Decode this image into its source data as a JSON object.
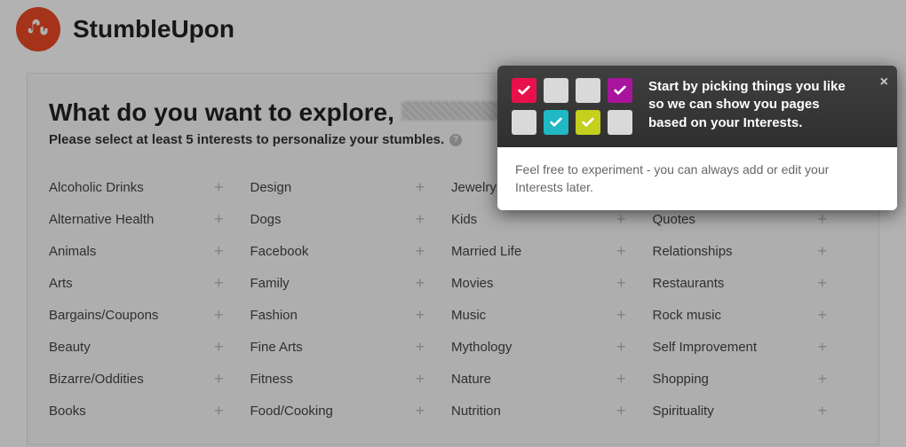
{
  "brand": "StumbleUpon",
  "heading_prefix": "What do you want to explore,",
  "subheading": "Please select at least 5 interests to personalize your stumbles.",
  "interests": {
    "col1": [
      "Alcoholic Drinks",
      "Alternative Health",
      "Animals",
      "Arts",
      "Bargains/Coupons",
      "Beauty",
      "Bizarre/Oddities",
      "Books"
    ],
    "col2": [
      "Design",
      "Dogs",
      "Facebook",
      "Family",
      "Fashion",
      "Fine Arts",
      "Fitness",
      "Food/Cooking"
    ],
    "col3": [
      "Jewelry",
      "Kids",
      "Married Life",
      "Movies",
      "Music",
      "Mythology",
      "Nature",
      "Nutrition"
    ],
    "col4": [
      "",
      "Quotes",
      "Relationships",
      "Restaurants",
      "Rock music",
      "Self Improvement",
      "Shopping",
      "Spirituality"
    ]
  },
  "popover": {
    "headline": "Start by picking things you like so we can show you pages based on your Interests.",
    "body": "Feel free to experiment - you can always add or edit your Interests later.",
    "boxes": [
      {
        "class": "b-red",
        "check": true,
        "color": "#fff"
      },
      {
        "class": "b-empty",
        "check": false
      },
      {
        "class": "b-empty",
        "check": false
      },
      {
        "class": "b-mag",
        "check": true,
        "color": "#fff"
      },
      {
        "class": "b-empty",
        "check": false
      },
      {
        "class": "b-teal",
        "check": true,
        "color": "#fff"
      },
      {
        "class": "b-lime",
        "check": true,
        "color": "#fff"
      },
      {
        "class": "b-empty",
        "check": false
      }
    ]
  }
}
